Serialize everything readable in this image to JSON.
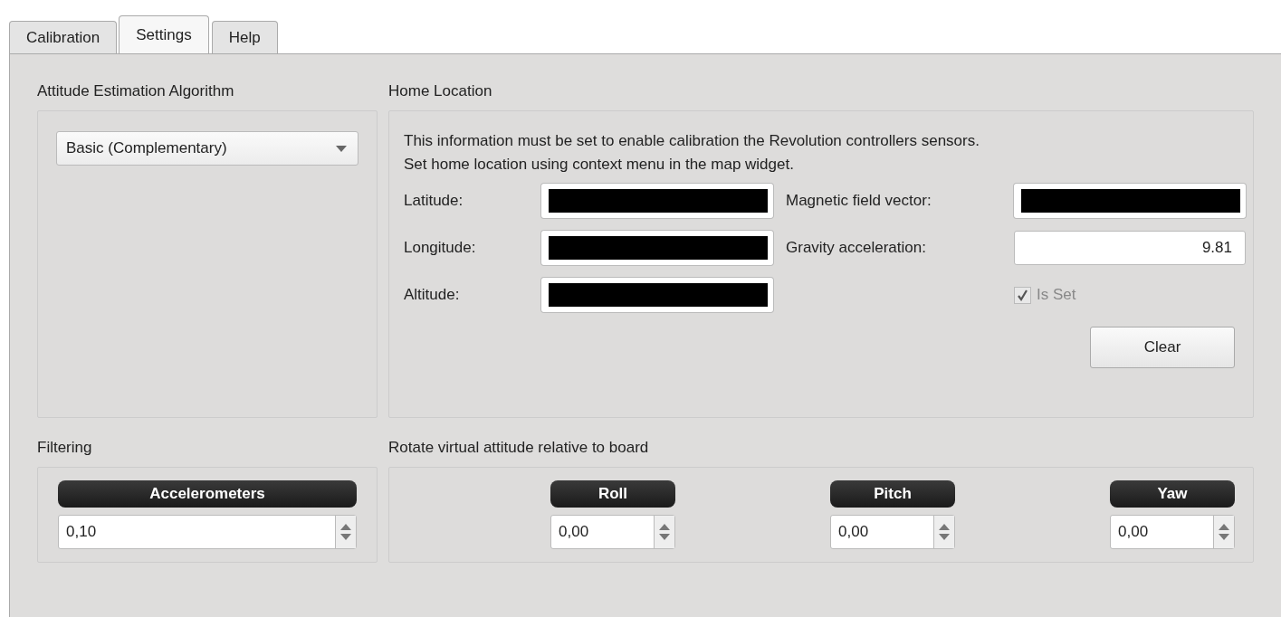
{
  "tabs": [
    {
      "label": "Calibration",
      "selected": false
    },
    {
      "label": "Settings",
      "selected": true
    },
    {
      "label": "Help",
      "selected": false
    }
  ],
  "attitude": {
    "title": "Attitude Estimation Algorithm",
    "dropdown": "Basic (Complementary)"
  },
  "home_location": {
    "title": "Home Location",
    "info": [
      "This information must be set to enable calibration the Revolution controllers sensors.",
      "Set home location using context menu in the map widget."
    ],
    "fields": [
      {
        "label": "Latitude:",
        "redacted": true
      },
      {
        "label": "Magnetic field vector:",
        "redacted": true
      },
      {
        "label": "Longitude:",
        "redacted": true
      },
      {
        "label": "Gravity acceleration:",
        "redacted": false,
        "value": "9.81"
      },
      {
        "label": "Altitude:",
        "redacted": true
      }
    ],
    "is_set": {
      "label": "Is Set",
      "checked": true,
      "disabled": true
    },
    "clear_button": "Clear"
  },
  "filtering": {
    "title": "Filtering",
    "spinners": [
      {
        "label": "Accelerometers",
        "value": "0,10"
      }
    ]
  },
  "rotation": {
    "title": "Rotate virtual attitude relative to board",
    "spinners": [
      {
        "label": "Roll",
        "value": "0,00"
      },
      {
        "label": "Pitch",
        "value": "0,00"
      },
      {
        "label": "Yaw",
        "value": "0,00"
      }
    ]
  }
}
